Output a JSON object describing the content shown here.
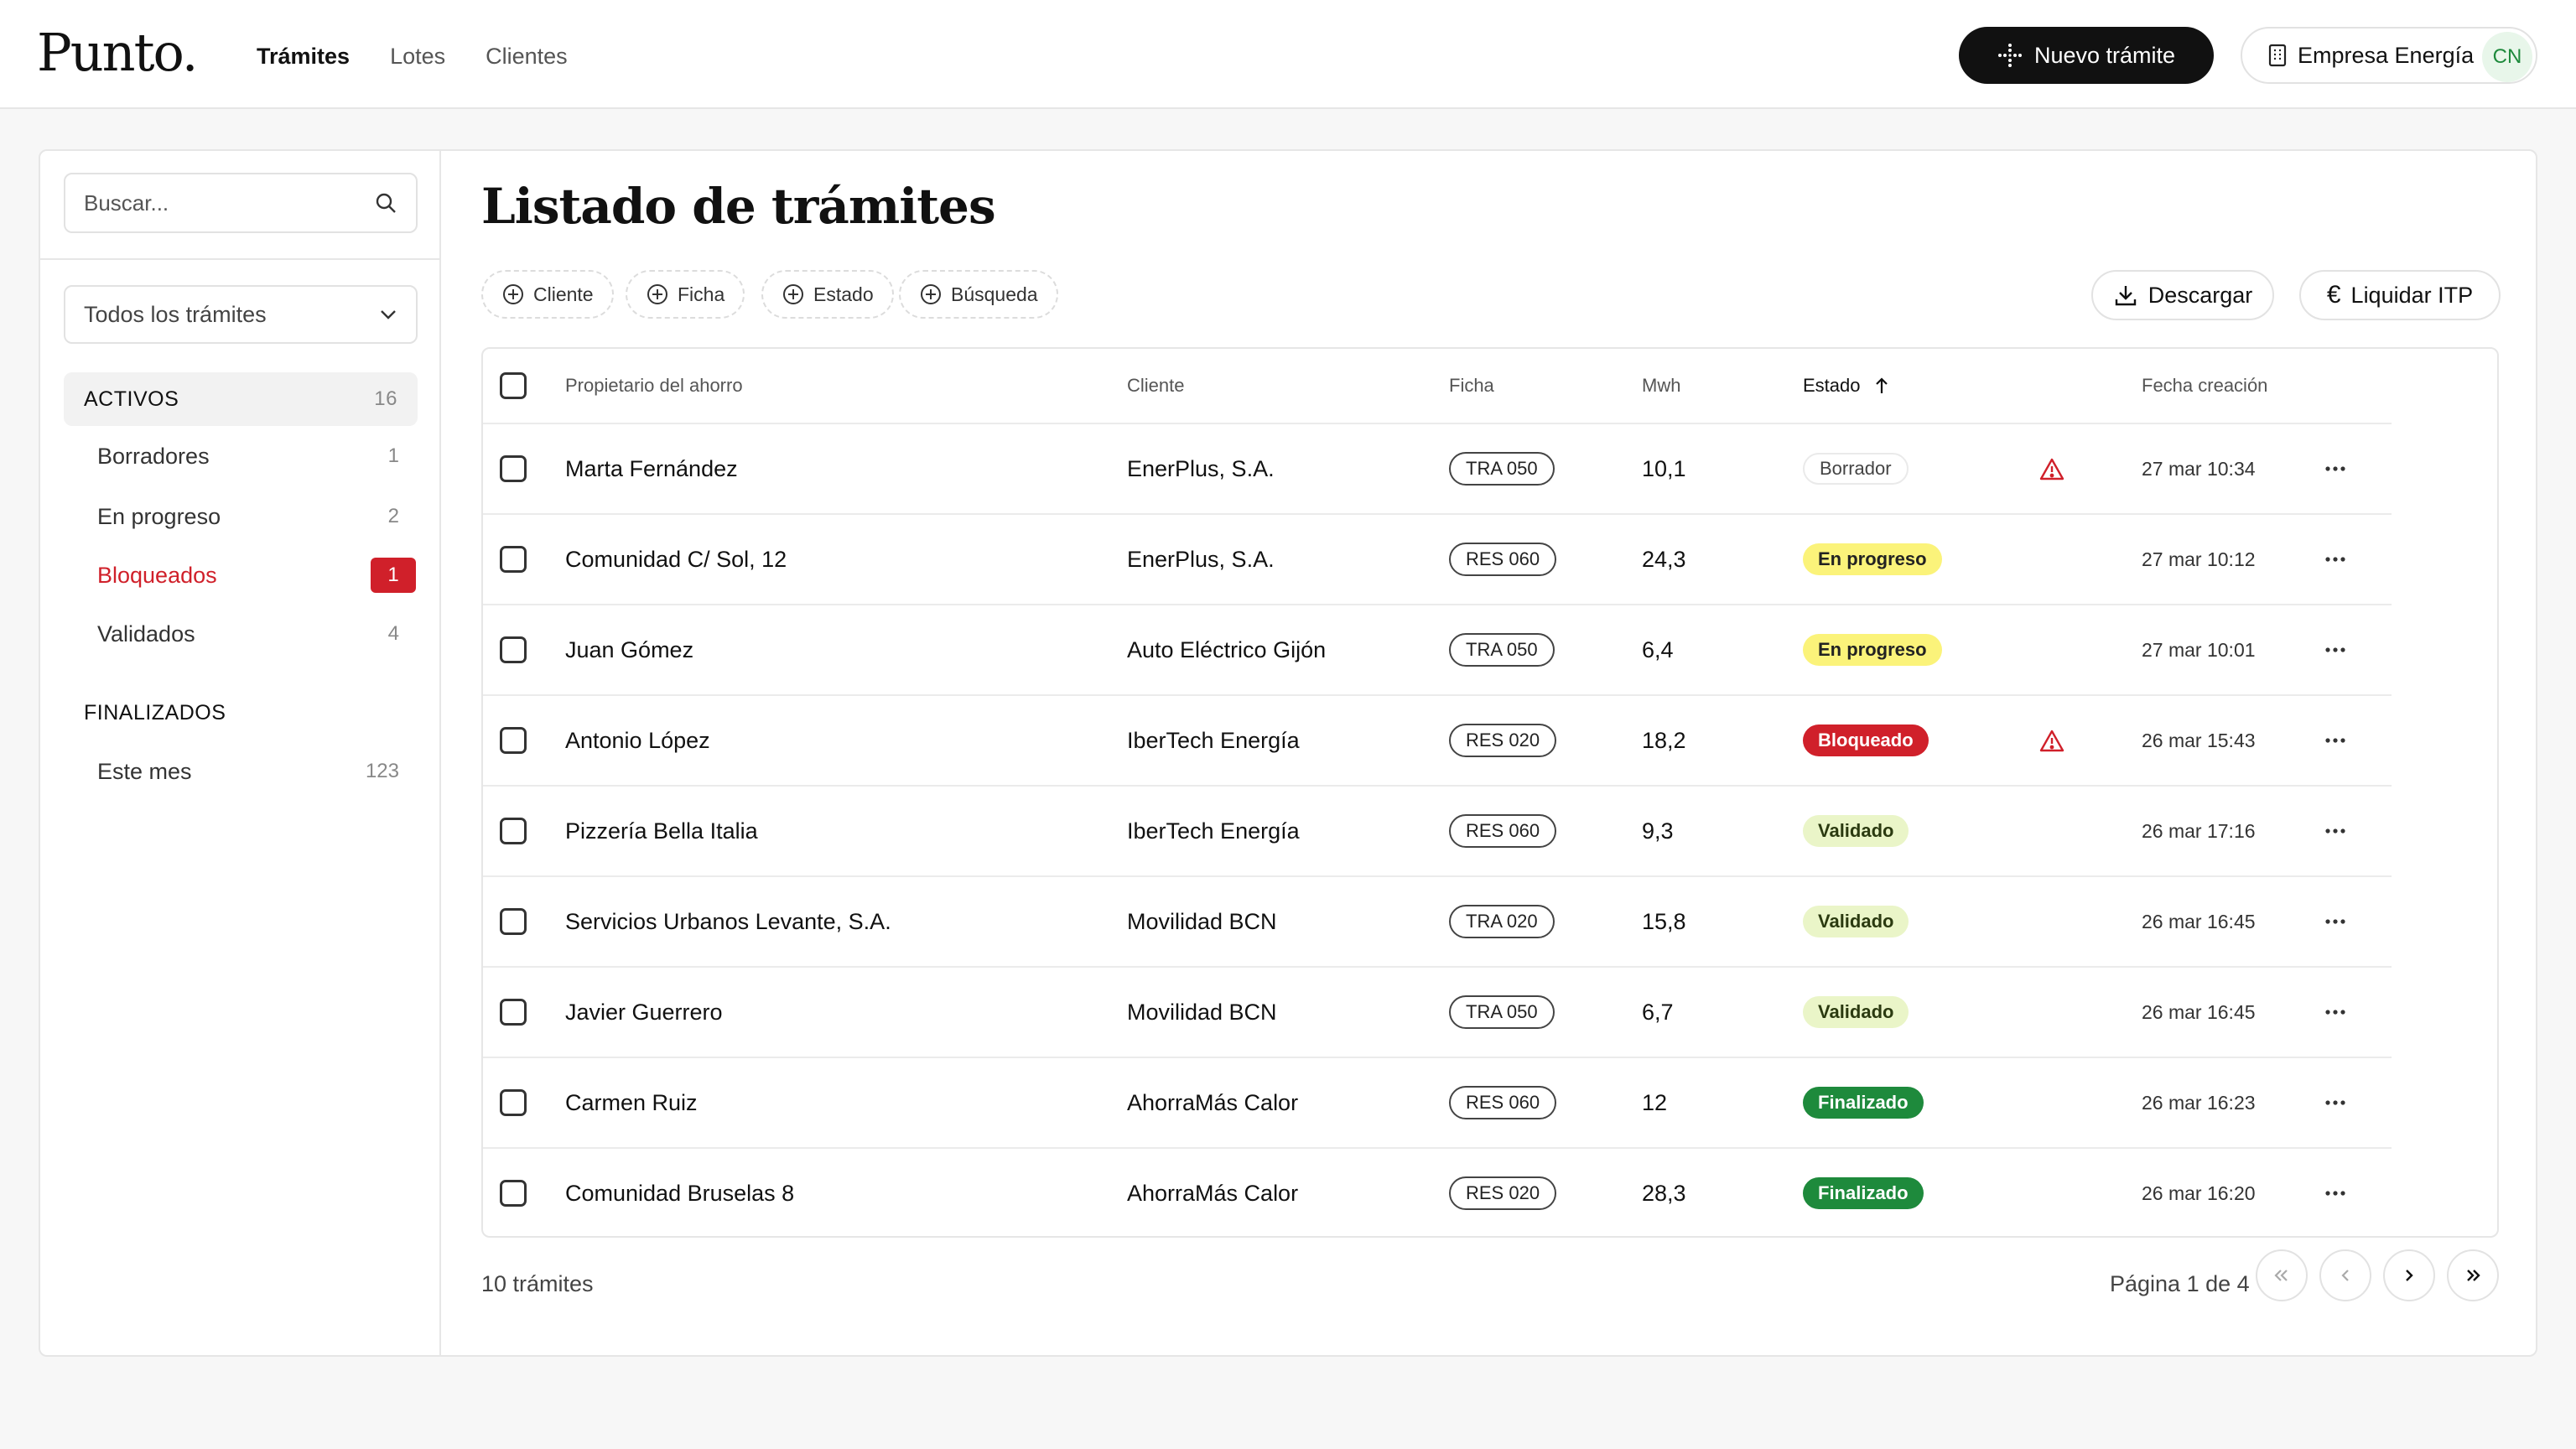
{
  "app": {
    "logo": "Punto.",
    "nav": [
      {
        "label": "Trámites",
        "active": true
      },
      {
        "label": "Lotes",
        "active": false
      },
      {
        "label": "Clientes",
        "active": false
      }
    ],
    "new_button": "Nuevo trámite",
    "company": "Empresa Energía",
    "avatar_initials": "CN"
  },
  "sidebar": {
    "search_placeholder": "Buscar...",
    "filter_select": "Todos los trámites",
    "groups": [
      {
        "label": "ACTIVOS",
        "count": "16",
        "items": [
          {
            "label": "Borradores",
            "count": "1",
            "alert": false
          },
          {
            "label": "En progreso",
            "count": "2",
            "alert": false
          },
          {
            "label": "Bloqueados",
            "count": "1",
            "alert": true
          },
          {
            "label": "Validados",
            "count": "4",
            "alert": false
          }
        ]
      },
      {
        "label": "FINALIZADOS",
        "count": "",
        "items": [
          {
            "label": "Este mes",
            "count": "123",
            "alert": false
          }
        ]
      }
    ]
  },
  "main": {
    "title": "Listado de trámites",
    "filters": [
      "Cliente",
      "Ficha",
      "Estado",
      "Búsqueda"
    ],
    "download_button": "Descargar",
    "liquidar_button": "Liquidar ITP",
    "columns": {
      "owner": "Propietario del ahorro",
      "client": "Cliente",
      "ficha": "Ficha",
      "mwh": "Mwh",
      "estado": "Estado",
      "fecha": "Fecha creación"
    },
    "rows": [
      {
        "owner": "Marta Fernández",
        "client": "EnerPlus, S.A.",
        "ficha": "TRA 050",
        "mwh": "10,1",
        "status": "Borrador",
        "status_kind": "borrador",
        "warning": true,
        "date": "27 mar 10:34"
      },
      {
        "owner": "Comunidad C/ Sol, 12",
        "client": "EnerPlus, S.A.",
        "ficha": "RES 060",
        "mwh": "24,3",
        "status": "En progreso",
        "status_kind": "progreso",
        "warning": false,
        "date": "27 mar 10:12"
      },
      {
        "owner": "Juan Gómez",
        "client": "Auto Eléctrico Gijón",
        "ficha": "TRA 050",
        "mwh": "6,4",
        "status": "En progreso",
        "status_kind": "progreso",
        "warning": false,
        "date": "27 mar 10:01"
      },
      {
        "owner": "Antonio López",
        "client": "IberTech Energía",
        "ficha": "RES 020",
        "mwh": "18,2",
        "status": "Bloqueado",
        "status_kind": "bloqueado",
        "warning": true,
        "date": "26 mar 15:43"
      },
      {
        "owner": "Pizzería Bella Italia",
        "client": "IberTech Energía",
        "ficha": "RES 060",
        "mwh": "9,3",
        "status": "Validado",
        "status_kind": "validado",
        "warning": false,
        "date": "26 mar 17:16"
      },
      {
        "owner": "Servicios Urbanos Levante, S.A.",
        "client": "Movilidad BCN",
        "ficha": "TRA 020",
        "mwh": "15,8",
        "status": "Validado",
        "status_kind": "validado",
        "warning": false,
        "date": "26 mar 16:45"
      },
      {
        "owner": "Javier Guerrero",
        "client": "Movilidad BCN",
        "ficha": "TRA 050",
        "mwh": "6,7",
        "status": "Validado",
        "status_kind": "validado",
        "warning": false,
        "date": "26 mar 16:45"
      },
      {
        "owner": "Carmen Ruiz",
        "client": "AhorraMás Calor",
        "ficha": "RES 060",
        "mwh": "12",
        "status": "Finalizado",
        "status_kind": "finalizado",
        "warning": false,
        "date": "26 mar 16:23"
      },
      {
        "owner": "Comunidad Bruselas 8",
        "client": "AhorraMás Calor",
        "ficha": "RES 020",
        "mwh": "28,3",
        "status": "Finalizado",
        "status_kind": "finalizado",
        "warning": false,
        "date": "26 mar 16:20"
      }
    ],
    "total_label": "10 trámites",
    "page_label": "Página 1 de 4"
  },
  "colors": {
    "accent_dark": "#111111",
    "danger": "#d0202a",
    "success": "#1e8a3c",
    "progress": "#fbf37a",
    "validated": "#eaf5c8"
  },
  "icons": [
    "sparkle-icon",
    "building-icon",
    "search-icon",
    "chevron-down-icon",
    "plus-circle-icon",
    "download-icon",
    "euro-icon",
    "sort-up-icon",
    "warning-icon",
    "more-icon",
    "first-page-icon",
    "prev-page-icon",
    "next-page-icon",
    "last-page-icon"
  ]
}
